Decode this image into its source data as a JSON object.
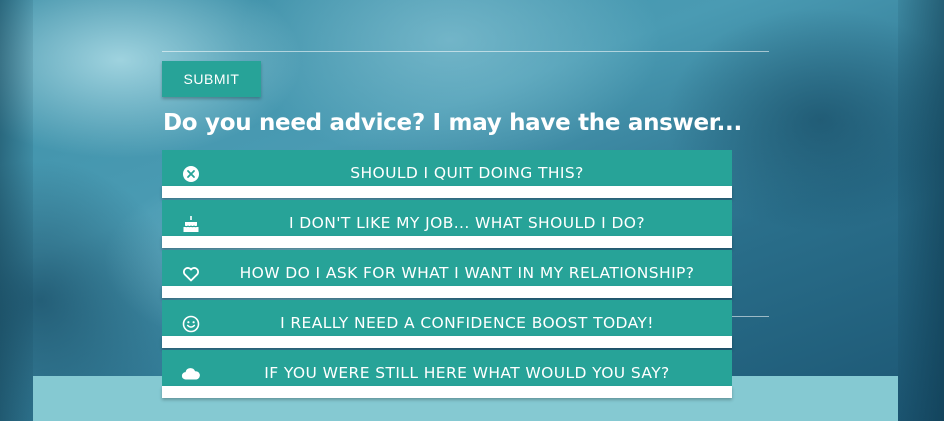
{
  "form": {
    "submit_label": "SUBMIT"
  },
  "section": {
    "heading": "Do you need advice? I may have the answer..."
  },
  "questions": [
    {
      "label": "SHOULD I QUIT DOING THIS?",
      "icon": "close-circle-icon"
    },
    {
      "label": "I DON'T LIKE MY JOB... WHAT SHOULD I DO?",
      "icon": "cake-icon"
    },
    {
      "label": "HOW DO I ASK FOR WHAT I WANT IN MY RELATIONSHIP?",
      "icon": "heart-icon"
    },
    {
      "label": "I REALLY NEED A CONFIDENCE BOOST TODAY!",
      "icon": "smiley-icon"
    },
    {
      "label": "IF YOU WERE STILL HERE WHAT WOULD YOU SAY?",
      "icon": "cloud-icon"
    }
  ],
  "colors": {
    "accent": "#27a398",
    "band": "#85c9d2",
    "text": "#ffffff"
  }
}
